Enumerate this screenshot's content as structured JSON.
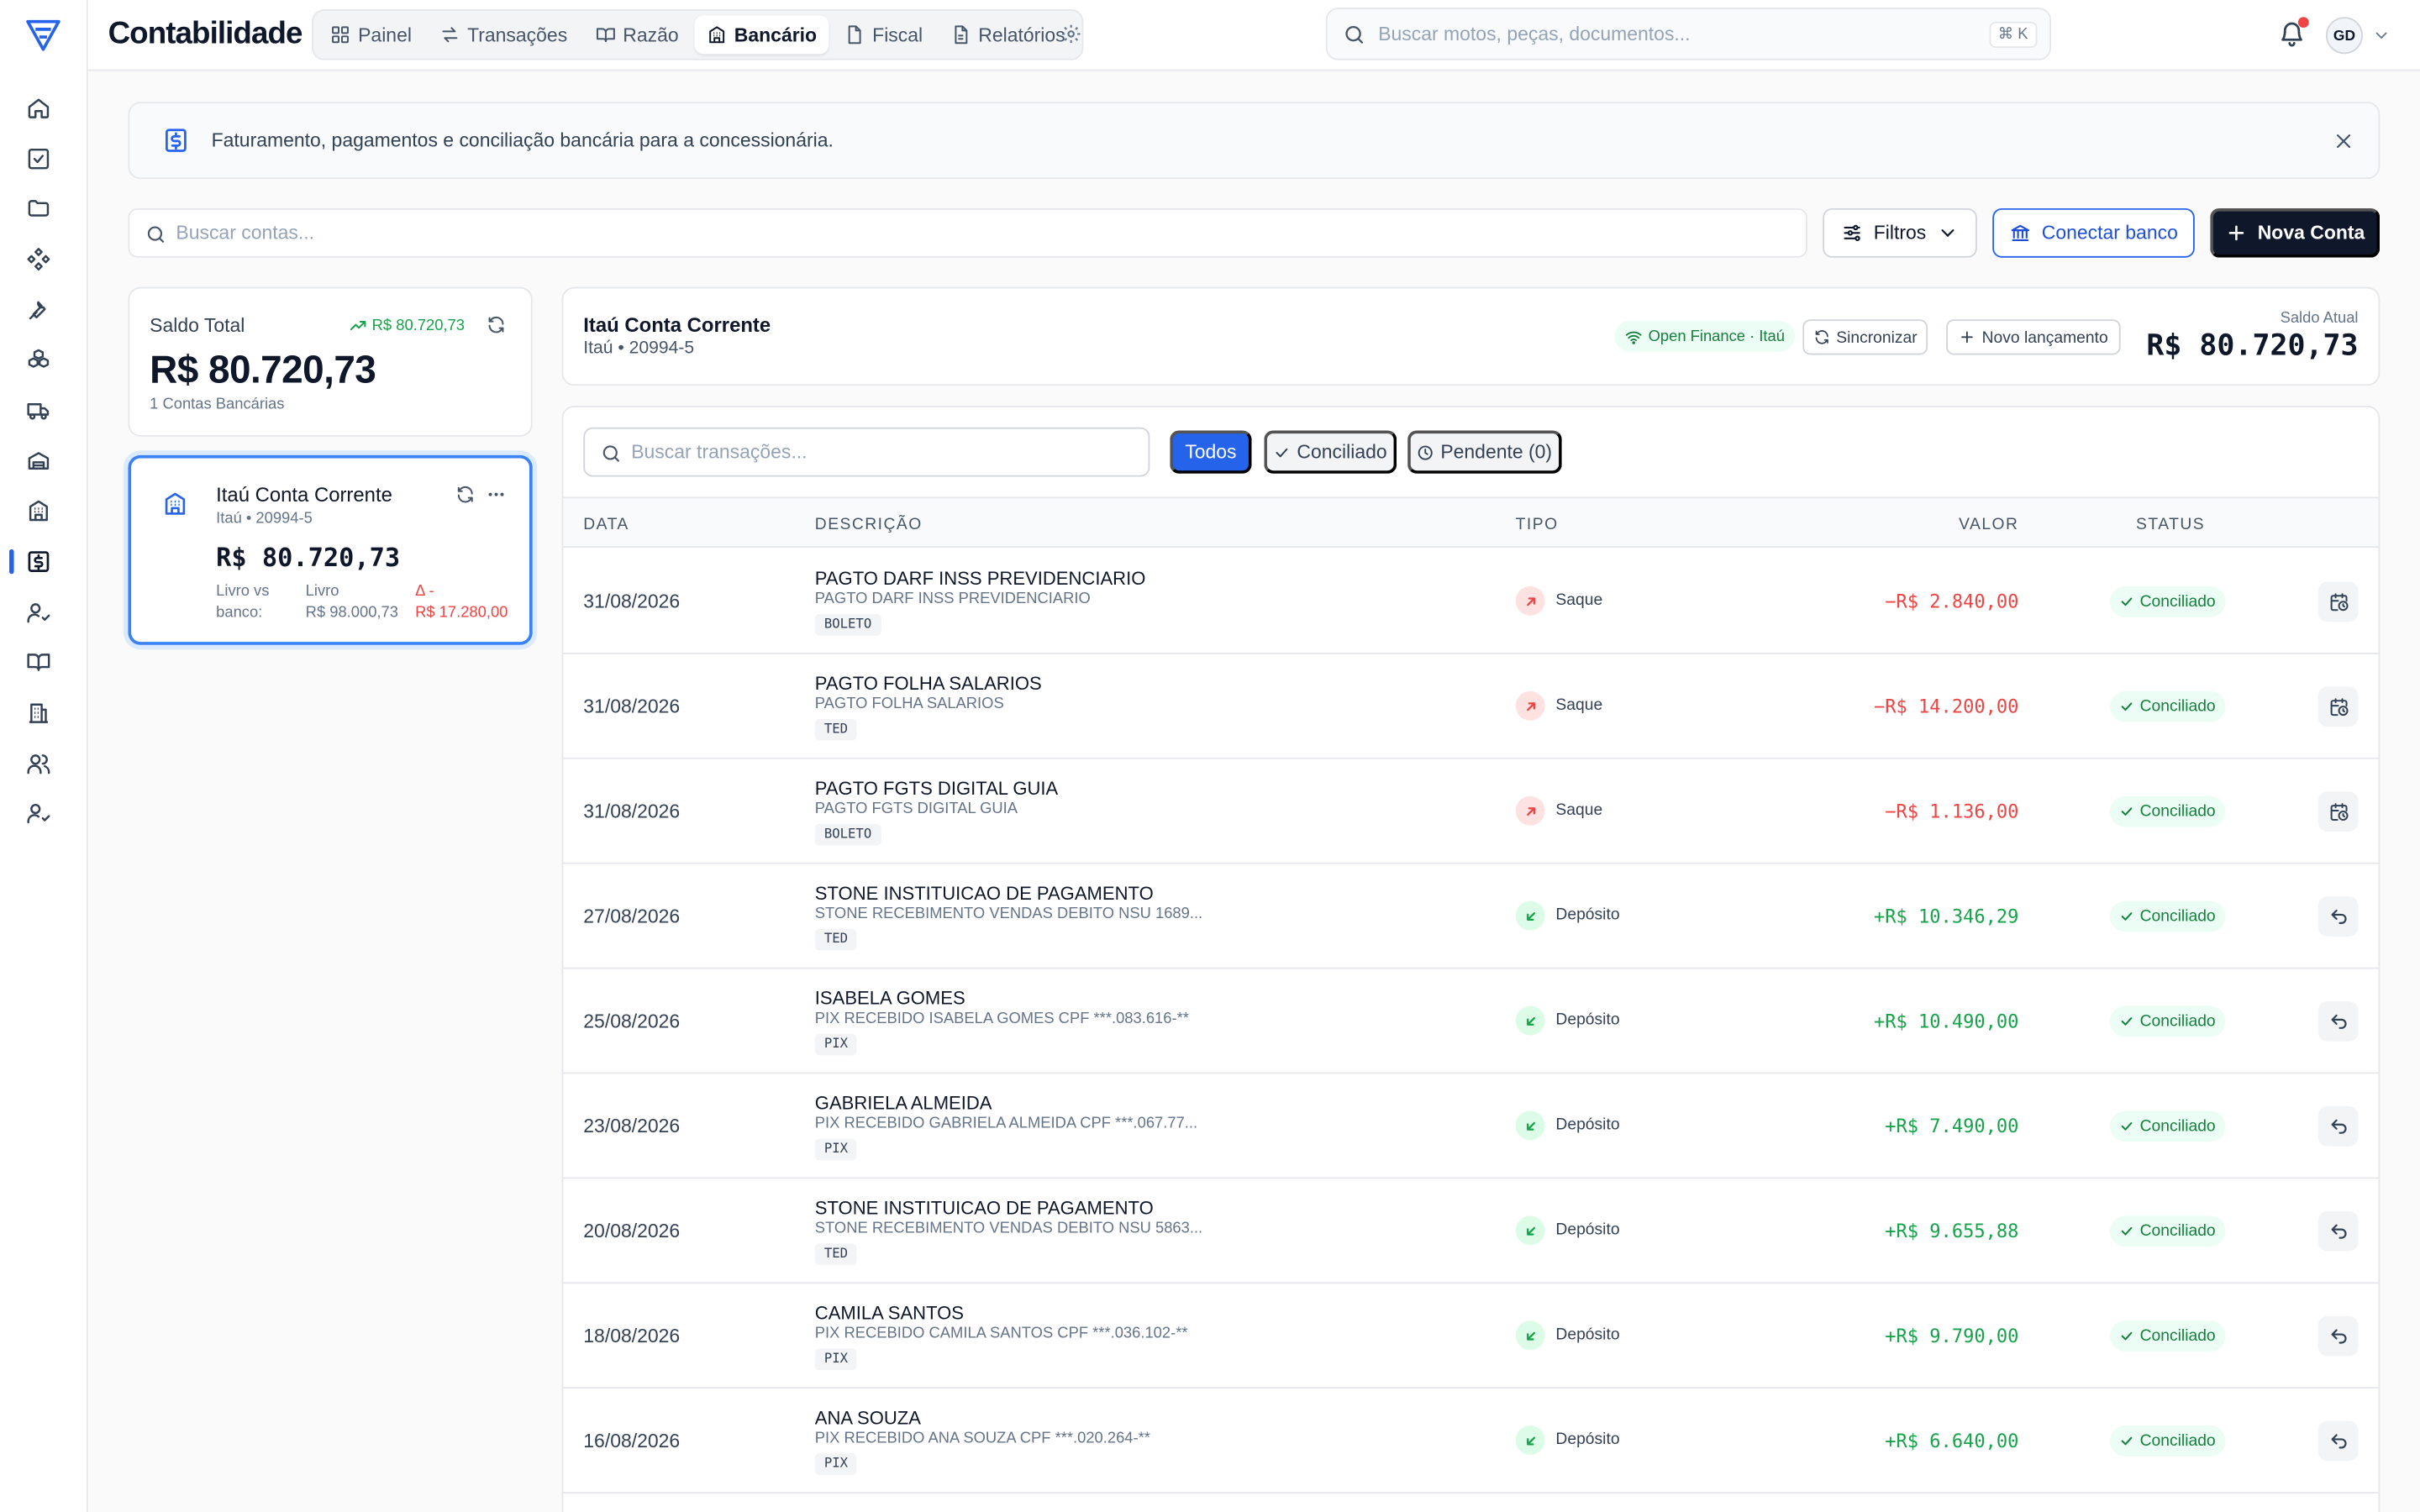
{
  "app": {
    "title": "Contabilidade"
  },
  "nav": {
    "tabs": [
      {
        "label": "Painel",
        "icon": "grid-icon"
      },
      {
        "label": "Transações",
        "icon": "arrows-icon"
      },
      {
        "label": "Razão",
        "icon": "book-icon"
      },
      {
        "label": "Bancário",
        "icon": "bank-icon",
        "active": true
      },
      {
        "label": "Fiscal",
        "icon": "file-icon"
      },
      {
        "label": "Relatórios",
        "icon": "report-icon"
      }
    ]
  },
  "header": {
    "search_placeholder": "Buscar motos, peças, documentos...",
    "shortcut": "⌘ K",
    "avatar_initials": "GD"
  },
  "banner": {
    "text": "Faturamento, pagamentos e conciliação bancária para a concessionária."
  },
  "toolbar": {
    "search_placeholder": "Buscar contas...",
    "filters_label": "Filtros",
    "connect_label": "Conectar banco",
    "new_label": "Nova Conta"
  },
  "summary": {
    "label": "Saldo Total",
    "trend": "R$ 80.720,73",
    "value": "R$ 80.720,73",
    "sub": "1 Contas Bancárias"
  },
  "account_card": {
    "name": "Itaú Conta Corrente",
    "sub": "Itaú • 20994-5",
    "value": "R$ 80.720,73",
    "livro_vs_banco_label": "Livro vs banco:",
    "livro_label": "Livro",
    "livro_value": "R$ 98.000,73",
    "delta_label": "Δ -",
    "delta_value": "R$ 17.280,00"
  },
  "account_header": {
    "name": "Itaú Conta Corrente",
    "sub": "Itaú • 20994-5",
    "open_finance": "Open Finance · Itaú",
    "sync_label": "Sincronizar",
    "new_entry_label": "Novo lançamento",
    "saldo_label": "Saldo Atual",
    "saldo_value": "R$ 80.720,73"
  },
  "transactions": {
    "search_placeholder": "Buscar transações...",
    "filters": {
      "all": "Todos",
      "reconciled": "Conciliado",
      "pending": "Pendente (0)"
    },
    "columns": {
      "date": "Data",
      "description": "Descrição",
      "type": "Tipo",
      "value": "Valor",
      "status": "Status"
    },
    "rows": [
      {
        "date": "31/08/2026",
        "title": "PAGTO DARF INSS PREVIDENCIARIO",
        "desc": "PAGTO DARF INSS PREVIDENCIARIO",
        "badge": "BOLETO",
        "type": "Saque",
        "direction": "out",
        "value": "−R$ 2.840,00",
        "status": "Conciliado",
        "action_icon": "calendar-clock-icon"
      },
      {
        "date": "31/08/2026",
        "title": "PAGTO FOLHA SALARIOS",
        "desc": "PAGTO FOLHA SALARIOS",
        "badge": "TED",
        "type": "Saque",
        "direction": "out",
        "value": "−R$ 14.200,00",
        "status": "Conciliado",
        "action_icon": "calendar-clock-icon"
      },
      {
        "date": "31/08/2026",
        "title": "PAGTO FGTS DIGITAL GUIA",
        "desc": "PAGTO FGTS DIGITAL GUIA",
        "badge": "BOLETO",
        "type": "Saque",
        "direction": "out",
        "value": "−R$ 1.136,00",
        "status": "Conciliado",
        "action_icon": "calendar-clock-icon"
      },
      {
        "date": "27/08/2026",
        "title": "STONE INSTITUICAO DE PAGAMENTO",
        "desc": "STONE RECEBIMENTO VENDAS DEBITO NSU 1689...",
        "badge": "TED",
        "type": "Depósito",
        "direction": "in",
        "value": "+R$ 10.346,29",
        "status": "Conciliado",
        "action_icon": "undo-icon"
      },
      {
        "date": "25/08/2026",
        "title": "ISABELA GOMES",
        "desc": "PIX RECEBIDO ISABELA GOMES CPF ***.083.616-**",
        "badge": "PIX",
        "type": "Depósito",
        "direction": "in",
        "value": "+R$ 10.490,00",
        "status": "Conciliado",
        "action_icon": "undo-icon"
      },
      {
        "date": "23/08/2026",
        "title": "GABRIELA ALMEIDA",
        "desc": "PIX RECEBIDO GABRIELA ALMEIDA CPF ***.067.77...",
        "badge": "PIX",
        "type": "Depósito",
        "direction": "in",
        "value": "+R$ 7.490,00",
        "status": "Conciliado",
        "action_icon": "undo-icon"
      },
      {
        "date": "20/08/2026",
        "title": "STONE INSTITUICAO DE PAGAMENTO",
        "desc": "STONE RECEBIMENTO VENDAS DEBITO NSU 5863...",
        "badge": "TED",
        "type": "Depósito",
        "direction": "in",
        "value": "+R$ 9.655,88",
        "status": "Conciliado",
        "action_icon": "undo-icon"
      },
      {
        "date": "18/08/2026",
        "title": "CAMILA SANTOS",
        "desc": "PIX RECEBIDO CAMILA SANTOS CPF ***.036.102-**",
        "badge": "PIX",
        "type": "Depósito",
        "direction": "in",
        "value": "+R$ 9.790,00",
        "status": "Conciliado",
        "action_icon": "undo-icon"
      },
      {
        "date": "16/08/2026",
        "title": "ANA SOUZA",
        "desc": "PIX RECEBIDO ANA SOUZA CPF ***.020.264-**",
        "badge": "PIX",
        "type": "Depósito",
        "direction": "in",
        "value": "+R$ 6.640,00",
        "status": "Conciliado",
        "action_icon": "undo-icon"
      }
    ]
  },
  "colors": {
    "accent": "#2563eb",
    "dark": "#0f172a",
    "positive": "#16a34a",
    "negative": "#ef4444"
  }
}
